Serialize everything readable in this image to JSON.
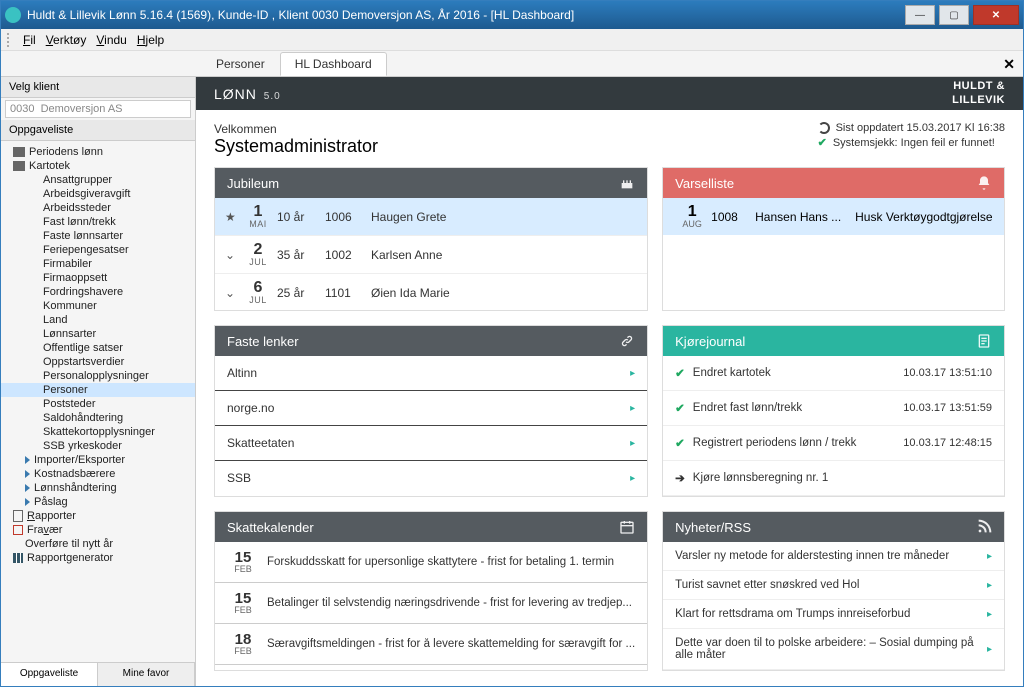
{
  "window": {
    "title": "Huldt & Lillevik Lønn 5.16.4 (1569), Kunde-ID , Klient 0030 Demoversjon AS, År 2016 - [HL Dashboard]"
  },
  "menu": {
    "file": "Fil",
    "tools": "Verktøy",
    "window": "Vindu",
    "help": "Hjelp"
  },
  "tabs": {
    "persons": "Personer",
    "dashboard": "HL Dashboard"
  },
  "sidebar": {
    "select_client": "Velg klient",
    "client_value": "0030  Demoversjon AS",
    "tasklist": "Oppgaveliste",
    "items": {
      "periodens_lonn": "Periodens lønn",
      "kartotek": "Kartotek",
      "ansattgrupper": "Ansattgrupper",
      "arbeidsgiveravgift": "Arbeidsgiveravgift",
      "arbeidssteder": "Arbeidssteder",
      "fast_lonntrekk": "Fast lønn/trekk",
      "faste_lonnsarter": "Faste lønnsarter",
      "feriepengesatser": "Feriepengesatser",
      "firmabiler": "Firmabiler",
      "firmaoppsett": "Firmaoppsett",
      "fordringshavere": "Fordringshavere",
      "kommuner": "Kommuner",
      "land": "Land",
      "lonnsarter": "Lønnsarter",
      "offentlige_satser": "Offentlige satser",
      "oppstartsverdier": "Oppstartsverdier",
      "personalopplysninger": "Personalopplysninger",
      "personer": "Personer",
      "poststeder": "Poststeder",
      "saldohandtering": "Saldohåndtering",
      "skattekortopplysninger": "Skattekortopplysninger",
      "ssb_yrkeskoder": "SSB yrkeskoder",
      "importer_eksporter": "Importer/Eksporter",
      "kostnadsbaerere": "Kostnadsbærere",
      "lonnshandtering": "Lønnshåndtering",
      "paslag": "Påslag",
      "rapporter": "Rapporter",
      "fravaer": "Fravær",
      "overfore": "Overføre til nytt år",
      "rapportgenerator": "Rapportgenerator"
    },
    "bottom_tabs": {
      "tasks": "Oppgaveliste",
      "fav": "Mine favor"
    }
  },
  "dash": {
    "lonn": "LØNN",
    "ver": "5.0",
    "brand1": "HULDT &",
    "brand2": "LILLEVIK",
    "welcome": "Velkommen",
    "role": "Systemadministrator",
    "updated": "Sist oppdatert 15.03.2017  Kl 16:38",
    "syscheck": "Systemsjekk: Ingen feil er funnet!"
  },
  "jubileum": {
    "title": "Jubileum",
    "rows": [
      {
        "day": "1",
        "mon": "MAI",
        "yrs": "10 år",
        "num": "1006",
        "name": "Haugen Grete"
      },
      {
        "day": "2",
        "mon": "JUL",
        "yrs": "35 år",
        "num": "1002",
        "name": "Karlsen Anne"
      },
      {
        "day": "6",
        "mon": "JUL",
        "yrs": "25 år",
        "num": "1101",
        "name": "Øien Ida Marie"
      }
    ]
  },
  "varsel": {
    "title": "Varselliste",
    "day": "1",
    "mon": "AUG",
    "num": "1008",
    "name": "Hansen Hans ...",
    "msg": "Husk Verktøygodtgjørelse"
  },
  "lenker": {
    "title": "Faste lenker",
    "items": [
      "Altinn",
      "norge.no",
      "Skatteetaten",
      "SSB"
    ]
  },
  "kjore": {
    "title": "Kjørejournal",
    "rows": [
      {
        "done": true,
        "txt": "Endret kartotek",
        "ts": "10.03.17 13:51:10"
      },
      {
        "done": true,
        "txt": "Endret fast lønn/trekk",
        "ts": "10.03.17 13:51:59"
      },
      {
        "done": true,
        "txt": "Registrert periodens lønn / trekk",
        "ts": "10.03.17 12:48:15"
      },
      {
        "done": false,
        "txt": "Kjøre lønnsberegning nr. 1",
        "ts": ""
      }
    ]
  },
  "skatt": {
    "title": "Skattekalender",
    "rows": [
      {
        "day": "15",
        "mon": "FEB",
        "txt": "Forskuddsskatt for upersonlige skattytere - frist for betaling 1. termin"
      },
      {
        "day": "15",
        "mon": "FEB",
        "txt": "Betalinger til selvstendig næringsdrivende - frist for levering av tredjep..."
      },
      {
        "day": "18",
        "mon": "FEB",
        "txt": "Særavgiftsmeldingen - frist for å levere skattemelding for særavgift for ..."
      }
    ]
  },
  "rss": {
    "title": "Nyheter/RSS",
    "items": [
      "Varsler ny metode for alderstesting innen tre måneder",
      "Turist savnet etter snøskred ved Hol",
      "Klart for rettsdrama om Trumps innreiseforbud",
      "Dette var doen til to polske arbeidere: – Sosial dumping på alle måter"
    ]
  }
}
